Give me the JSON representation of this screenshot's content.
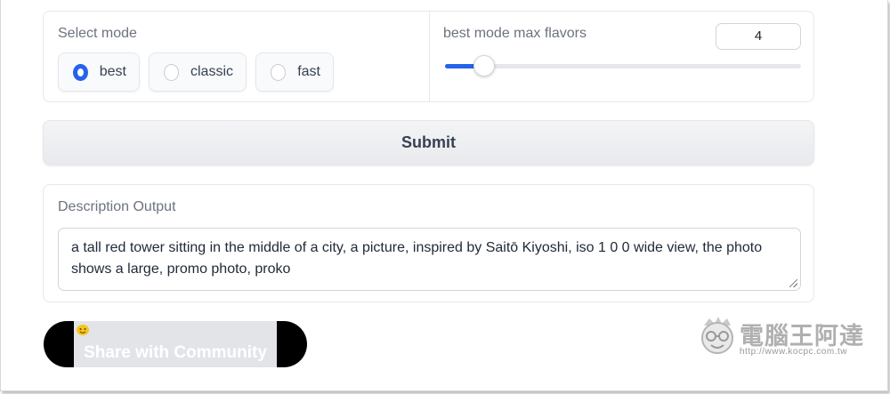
{
  "mode": {
    "label": "Select mode",
    "options": [
      {
        "label": "best",
        "selected": true
      },
      {
        "label": "classic",
        "selected": false
      },
      {
        "label": "fast",
        "selected": false
      }
    ]
  },
  "flavors": {
    "label": "best mode max flavors",
    "value": "4",
    "slider_fraction": 0.11
  },
  "submit": {
    "label": "Submit"
  },
  "output": {
    "label": "Description Output",
    "text": "a tall red tower sitting in the middle of a city, a picture, inspired by Saitō Kiyoshi, iso 1 0 0 wide view, the photo shows a large, promo photo, proko"
  },
  "share": {
    "label": "Share with Community"
  },
  "watermark": {
    "title": "電腦王阿達",
    "url": "http://www.kocpc.com.tw"
  },
  "colors": {
    "accent": "#2563eb",
    "panel_border": "#e5e7eb"
  },
  "icons": {
    "share": "hugging-face-icon",
    "watermark": "mascot-face-icon"
  }
}
